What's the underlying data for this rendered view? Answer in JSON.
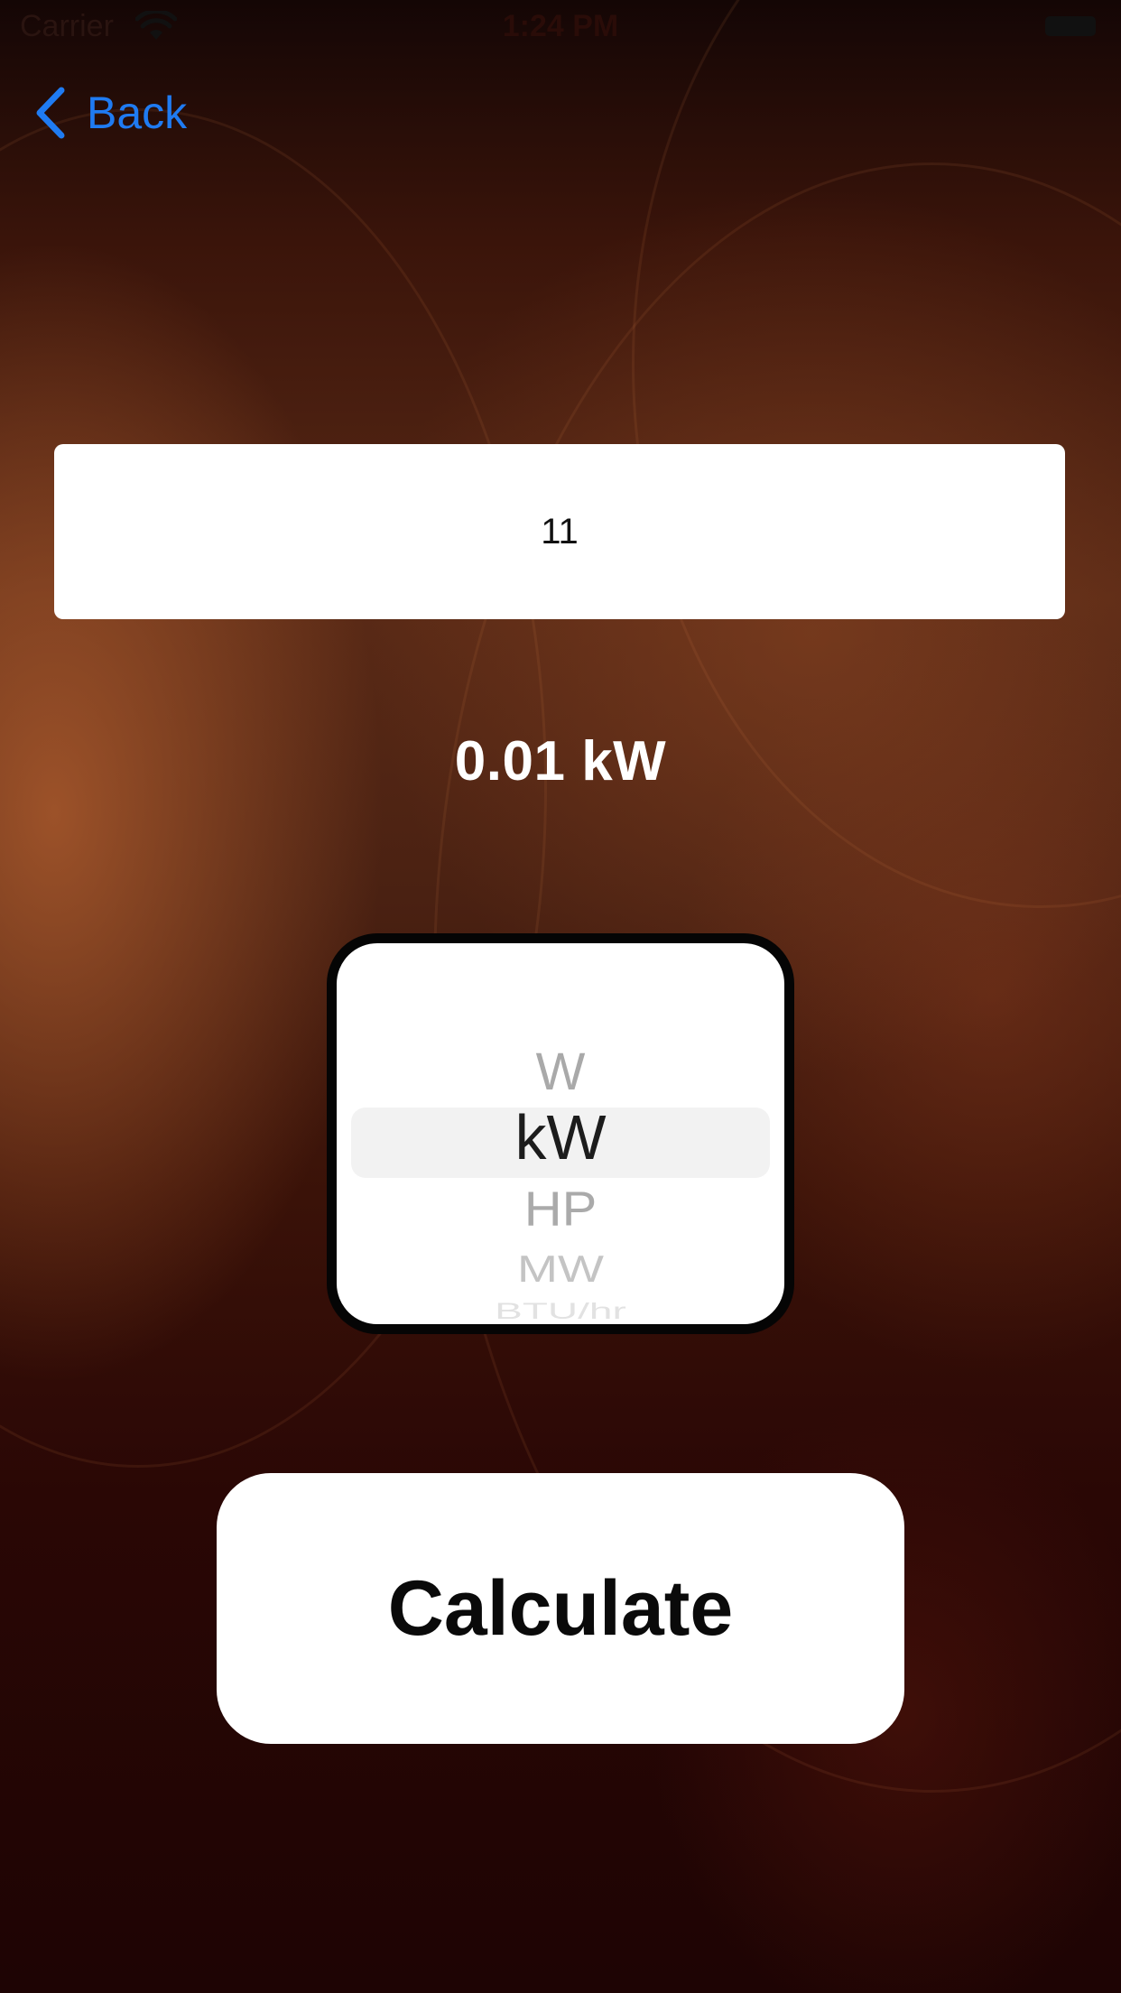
{
  "status_bar": {
    "carrier": "Carrier",
    "time": "1:24 PM"
  },
  "nav": {
    "back_label": "Back",
    "accent_color": "#1f7bf2"
  },
  "input": {
    "value": "11"
  },
  "result": {
    "text": "0.01 kW"
  },
  "picker": {
    "selected": "kW",
    "options": [
      "W",
      "kW",
      "HP",
      "MW",
      "BTU/hr"
    ]
  },
  "actions": {
    "calculate_label": "Calculate"
  }
}
